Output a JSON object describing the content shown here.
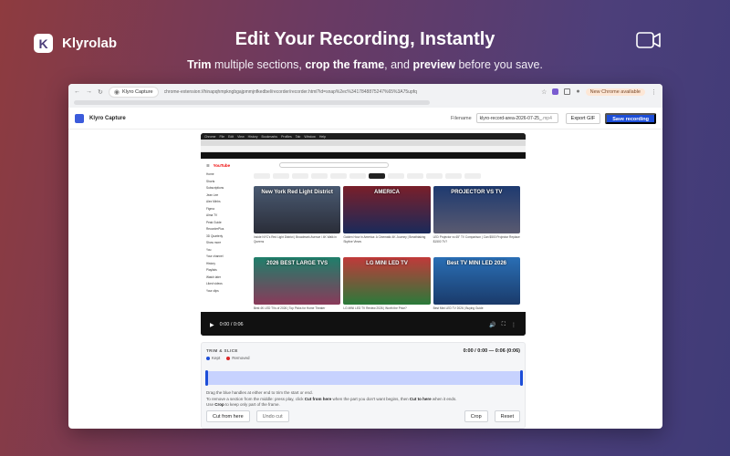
{
  "brand": {
    "name": "Klyrolab",
    "logo_letter": "K"
  },
  "hero": {
    "title": "Edit Your Recording, Instantly",
    "sub_1": "Trim",
    "sub_2": " multiple sections, ",
    "sub_3": "crop the frame",
    "sub_4": ", and ",
    "sub_5": "preview",
    "sub_6": " before you save."
  },
  "icons": {
    "camera": "video-camera-icon"
  },
  "browser": {
    "tab_title": "Klyro Capture",
    "url": "chrome-extension://hinapqhmpkngbgajpmmjnfkedbel/recorder/recorder.html?id=snap%2ec%3417848875247%65%3A75upfq",
    "new_chrome_label": "New Chrome available"
  },
  "app": {
    "title": "Klyro Capture",
    "filename_label": "Filename",
    "filename_value": "klyro-record-area-2026-07-25_",
    "filename_ext": ".mp4",
    "export_gif_label": "Export GIF",
    "save_label": "Save recording"
  },
  "video": {
    "menubar_items": [
      "Chrome",
      "File",
      "Edit",
      "View",
      "History",
      "Bookmarks",
      "Profiles",
      "Tab",
      "Window",
      "Help"
    ],
    "yt": {
      "logo": "YouTube",
      "side_items": [
        "Home",
        "Shorts",
        "Subscriptions",
        "Jean Lee",
        "Alex Minhs",
        "Figma",
        "Alma TV",
        "Peak Guide",
        "RecorderPlus",
        "3D Quarterly",
        "Show more",
        "You",
        "Your channel",
        "History",
        "Playlists",
        "Watch later",
        "Liked videos",
        "Your clips"
      ],
      "thumbs": [
        {
          "title": "New York Red Light District",
          "meta": "Inside NYC's Red Light District | Broadmark Avenue / 4K Walk in Queens"
        },
        {
          "title": "AMERICA",
          "meta": "Golden Hour in America: A Cinematic 4K Journey | Breathtaking Skyline Views"
        },
        {
          "title": "PROJECTOR VS TV",
          "meta": "LED Projector vs 65\" TV Comparison | Can $500 Projector Replace $1500 TV?"
        },
        {
          "title": "2026 BEST LARGE TVS",
          "meta": "Best 4K LED TVs of 2026 | Top Picks for Home Theater"
        },
        {
          "title": "LG MINI LED TV",
          "meta": "LG MINI LED TV Review 2026 | Worth the Price?"
        },
        {
          "title": "Best TV MINI LED 2026",
          "meta": "Best Mini LED TV 2026 | Buying Guide"
        }
      ]
    },
    "time": "0:00 / 0:06"
  },
  "trim": {
    "title": "TRIM & SLICE",
    "time_display": "0:00 / 0:00 — 0:06 (0:06)",
    "legend_kept": "Kept",
    "legend_removed": "Removed",
    "help_1": "Drag the blue handles at either end to trim the start or end.",
    "help_2a": "To remove a section from the middle: press play, click ",
    "help_2b": "Cut from here",
    "help_2c": " when the part you don't want begins, then ",
    "help_2d": "Cut to here",
    "help_2e": " when it ends.",
    "help_3a": "Use ",
    "help_3b": "Crop",
    "help_3c": " to keep only part of the frame.",
    "cut_from_label": "Cut from here",
    "undo_label": "Undo cut",
    "crop_label": "Crop",
    "reset_label": "Reset"
  },
  "colors": {
    "accent": "#1d4ed8",
    "removed": "#dc2626",
    "kept_track": "#c7d2fe"
  }
}
